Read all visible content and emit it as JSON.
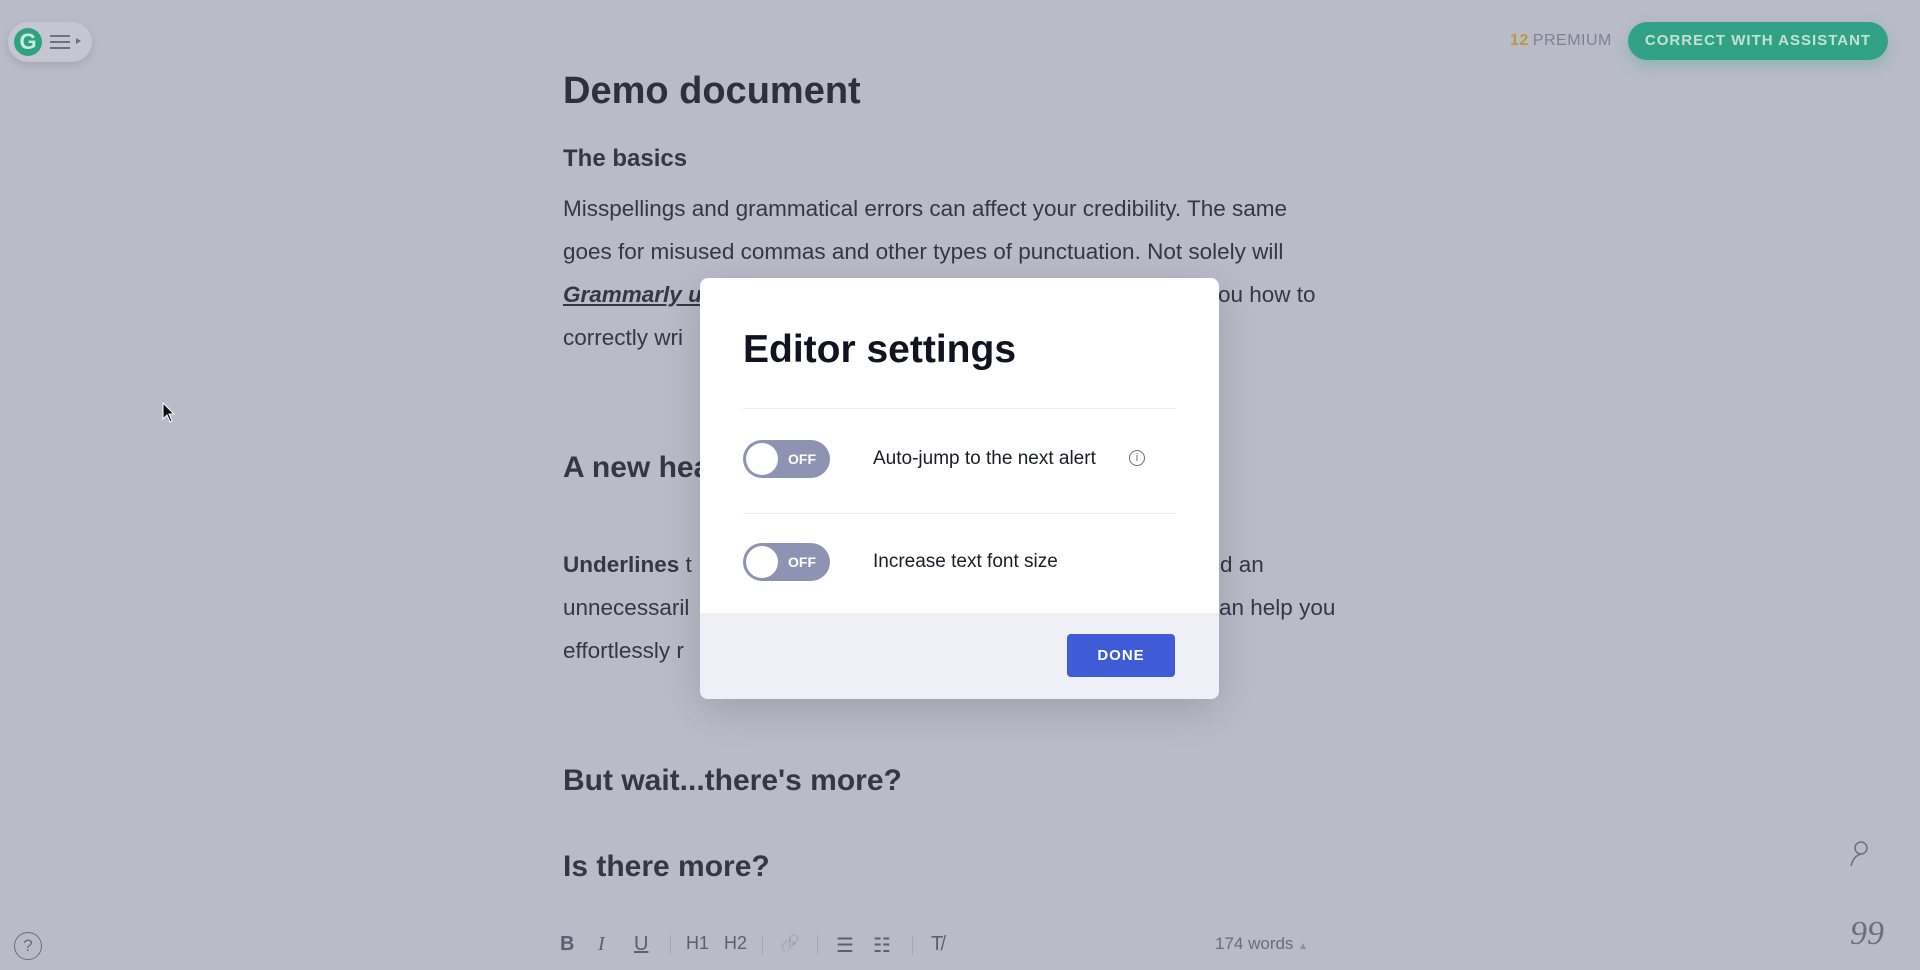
{
  "app": {
    "logo": "G",
    "premium_count": "12",
    "premium_label": "PREMIUM",
    "cta": "CORRECT WITH ASSISTANT"
  },
  "doc": {
    "title": "Demo document",
    "h_basics": "The basics",
    "p1": [
      "Misspellings and grammatical errors can affect your credibility. The same",
      "goes for misused commas and other types of punctuation. Not solely will"
    ],
    "p1_l3_left": "Grammarly u",
    "p1_l3_right": "ou how to",
    "p1_l4_left": "correctly wri",
    "h_new": "A new hea",
    "p2_l1_left": "Underlines",
    "p2_l1_left2": " t",
    "p2_l1_right": "d an",
    "p2_l2_left": "unnecessaril",
    "p2_l2_right": "an help you",
    "p2_l3_left": "effortlessly r",
    "h_wait": "But wait...there's more?",
    "h_more": "Is there more?"
  },
  "toolbar": {
    "bold": "B",
    "italic": "I",
    "underline": "U",
    "h1": "H1",
    "h2": "H2",
    "link": "🔗",
    "ol": "☰",
    "ul": "☷",
    "clear": "T̸",
    "word_count": "174 words",
    "caret": "▲"
  },
  "modal": {
    "title": "Editor settings",
    "settings": [
      {
        "label": "Auto-jump to the next alert",
        "state": "OFF",
        "on": false,
        "info": "i"
      },
      {
        "label": "Increase text font size",
        "state": "OFF",
        "on": false
      }
    ],
    "done": "DONE"
  },
  "side": {
    "help": "?",
    "quote": "99"
  },
  "colors": {
    "brand": "#31a285",
    "primary": "#3f5bd6",
    "toggle_off": "#8f93b3"
  }
}
